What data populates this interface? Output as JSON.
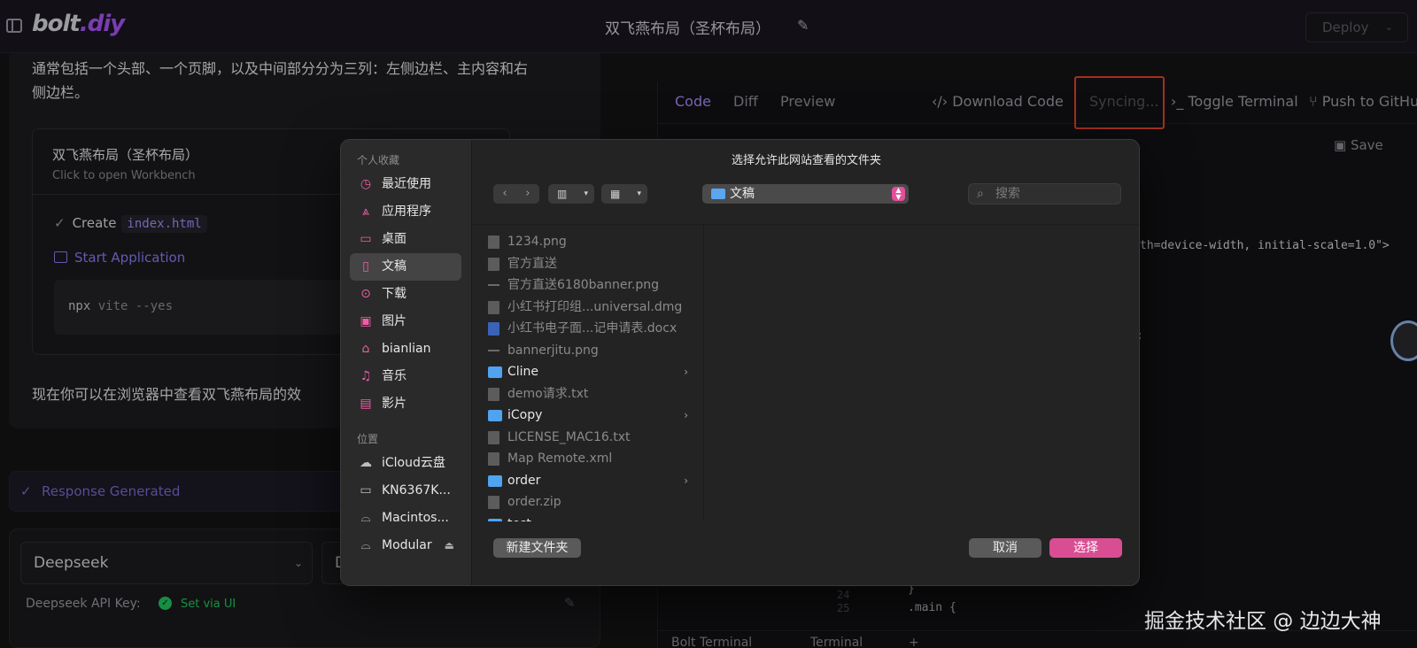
{
  "header": {
    "logo_text": "bolt",
    "logo_suffix": ".diy",
    "title": "双飞燕布局（圣杯布局）",
    "deploy_label": "Deploy"
  },
  "chat": {
    "intro_text": "通常包括一个头部、一个页脚，以及中间部分分为三列：左侧边栏、主内容和右侧边栏。",
    "artifact_title": "双飞燕布局（圣杯布局）",
    "artifact_subtitle": "Click to open Workbench",
    "step_create_label": "Create",
    "step_create_file": "index.html",
    "step_start_label": "Start Application",
    "command": "npx",
    "command_args": "vite --yes",
    "closing_text": "现在你可以在浏览器中查看双飞燕布局的效",
    "response_status": "Response Generated"
  },
  "input": {
    "provider": "Deepseek",
    "model_partial": "De",
    "api_key_label": "Deepseek API Key:",
    "api_key_status": "Set via UI"
  },
  "workbench": {
    "tabs": [
      "Code",
      "Diff",
      "Preview"
    ],
    "actions": {
      "download": "Download Code",
      "syncing": "Syncing...",
      "toggle_terminal": "Toggle Terminal",
      "push": "Push to GitHu"
    },
    "save_label": "Save",
    "code_fragment_1": "th=device-width, initial-scale=1.0\">",
    "code_fragment_2": ":",
    "line_25": "25",
    "line_24": "24",
    "code_line_brace": "}",
    "code_line_main": ".main {",
    "terminal_tabs": [
      "Bolt Terminal",
      "Terminal"
    ],
    "terminal_add": "+"
  },
  "dialog": {
    "title": "选择允许此网站查看的文件夹",
    "favorites_header": "个人收藏",
    "favorites": [
      {
        "label": "最近使用",
        "icon": "clock-icon"
      },
      {
        "label": "应用程序",
        "icon": "apps-icon"
      },
      {
        "label": "桌面",
        "icon": "desktop-icon"
      },
      {
        "label": "文稿",
        "icon": "document-icon",
        "selected": true
      },
      {
        "label": "下载",
        "icon": "download-icon"
      },
      {
        "label": "图片",
        "icon": "photo-icon"
      },
      {
        "label": "bianlian",
        "icon": "home-icon"
      },
      {
        "label": "音乐",
        "icon": "music-icon"
      },
      {
        "label": "影片",
        "icon": "film-icon"
      }
    ],
    "locations_header": "位置",
    "locations": [
      {
        "label": "iCloud云盘",
        "icon": "cloud-icon"
      },
      {
        "label": "KN6367K...",
        "icon": "laptop-icon"
      },
      {
        "label": "Macintos...",
        "icon": "disk-icon"
      },
      {
        "label": "Modular",
        "icon": "disk-icon",
        "ejectable": true
      }
    ],
    "location_select": "文稿",
    "search_placeholder": "搜索",
    "files": [
      {
        "name": "1234.png",
        "kind": "doc",
        "enabled": false
      },
      {
        "name": "官方直送",
        "kind": "doc",
        "enabled": false
      },
      {
        "name": "官方直送6180banner.png",
        "kind": "line",
        "enabled": false
      },
      {
        "name": "小红书打印组...universal.dmg",
        "kind": "doc",
        "enabled": false
      },
      {
        "name": "小红书电子面...记申请表.docx",
        "kind": "word",
        "enabled": false
      },
      {
        "name": "bannerjitu.png",
        "kind": "line",
        "enabled": false
      },
      {
        "name": "Cline",
        "kind": "folder",
        "enabled": true
      },
      {
        "name": "demo请求.txt",
        "kind": "doc",
        "enabled": false
      },
      {
        "name": "iCopy",
        "kind": "folder",
        "enabled": true
      },
      {
        "name": "LICENSE_MAC16.txt",
        "kind": "doc",
        "enabled": false
      },
      {
        "name": "Map Remote.xml",
        "kind": "doc",
        "enabled": false
      },
      {
        "name": "order",
        "kind": "folder",
        "enabled": true
      },
      {
        "name": "order.zip",
        "kind": "doc",
        "enabled": false
      },
      {
        "name": "test",
        "kind": "folder",
        "enabled": true
      }
    ],
    "new_folder_label": "新建文件夹",
    "cancel_label": "取消",
    "choose_label": "选择"
  },
  "watermark": "掘金技术社区 @ 边边大神",
  "colors": {
    "accent_purple": "#a78bfa",
    "highlight_red": "#e0452c",
    "dialog_primary": "#d94e93",
    "success_green": "#22c55e"
  }
}
